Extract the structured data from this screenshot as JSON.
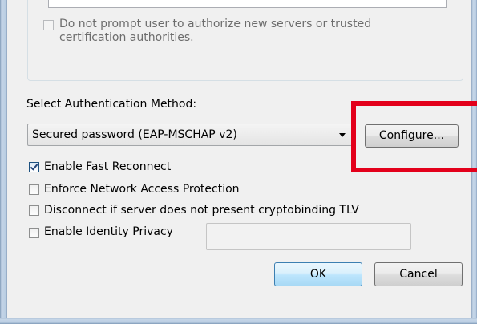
{
  "eap_settings": {
    "no_prompt_label_line1": "Do not prompt user to authorize new servers or trusted",
    "no_prompt_label_line2": "certification authorities.",
    "no_prompt_checked": false,
    "auth_method_label": "Select Authentication Method:",
    "auth_method_selected": "Secured password (EAP-MSCHAP v2)",
    "configure_label": "Configure...",
    "fast_reconnect_label": "Enable Fast Reconnect",
    "fast_reconnect_checked": true,
    "enforce_nap_label": "Enforce Network Access Protection",
    "enforce_nap_checked": false,
    "disconnect_tlv_label": "Disconnect if server does not present cryptobinding TLV",
    "disconnect_tlv_checked": false,
    "identity_privacy_label": "Enable Identity Privacy",
    "identity_privacy_checked": false,
    "identity_privacy_value": "",
    "ok_label": "OK",
    "cancel_label": "Cancel"
  },
  "colors": {
    "dialog_bg": "#f0f0f0",
    "highlight_border": "#e3001b",
    "window_frame": "#b9cde2"
  }
}
